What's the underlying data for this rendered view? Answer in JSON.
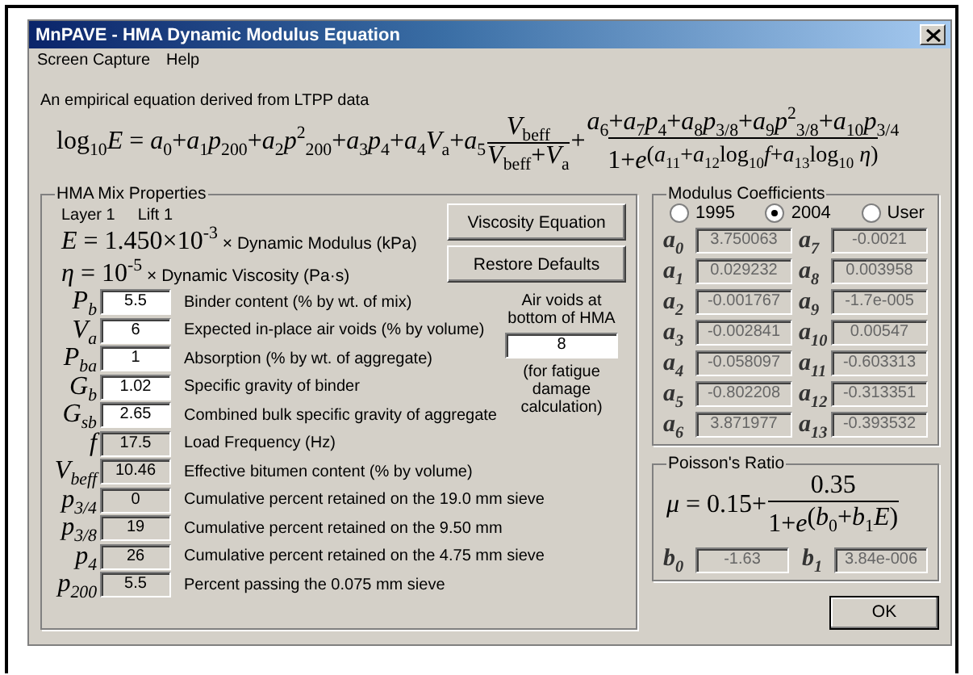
{
  "window": {
    "title": "MnPAVE - HMA Dynamic Modulus Equation"
  },
  "menu": [
    "Screen Capture",
    "Help"
  ],
  "intro": "An empirical equation derived from LTPP data",
  "equation": {
    "lhs": "log$_{10}$*E* = *a*$_{0}$+*a*$_{1}$*p*$_{200}$+*a*$_{2}$*p*$^{2}$$_{200}$+*a*$_{3}$*p*$_{4}$+*a*$_{4}$*V*$_{a}$+*a*$_{5}$",
    "frac1": {
      "num": "*V*$_{beff}$",
      "den": "*V*$_{beff}$+*V*$_{a}$"
    },
    "plus": "+",
    "frac2": {
      "num": "*a*$_{6}$+*a*$_{7}$*p*$_{4}$+*a*$_{8}$*p*$_{3/8}$+*a*$_{9}$*p*$^{2}$$_{3/8}$+*a*$_{10}$*p*$_{3/4}$",
      "den": "1+*e*",
      "exponent": "(*a*$_{11}$+*a*$_{12}$log$_{10}$*f*+*a*$_{13}$log$_{10}$ *η*)"
    }
  },
  "mix": {
    "title": "HMA Mix Properties",
    "layer": "Layer 1",
    "lift": "Lift 1",
    "defs": [
      {
        "math": "*E* = 1.450×10$^{-3}$",
        "text": "× Dynamic Modulus (kPa)"
      },
      {
        "math": "*η* = 10$^{-5}$",
        "text": "× Dynamic Viscosity (Pa·s)"
      }
    ],
    "buttons": [
      "Viscosity Equation",
      "Restore Defaults"
    ],
    "fields": [
      {
        "symbol": "P$_{b}$",
        "value": "5.5",
        "label": "Binder content (% by wt. of mix)",
        "editable": true
      },
      {
        "symbol": "V$_{a}$",
        "value": "6",
        "label": "Expected in-place air voids (% by volume)",
        "editable": true
      },
      {
        "symbol": "P$_{ba}$",
        "value": "1",
        "label": "Absorption (% by wt. of aggregate)",
        "editable": true
      },
      {
        "symbol": "G$_{b}$",
        "value": "1.02",
        "label": "Specific gravity of binder",
        "editable": true
      },
      {
        "symbol": "G$_{sb}$",
        "value": "2.65",
        "label": "Combined bulk specific gravity of aggregate",
        "editable": true
      },
      {
        "symbol": "f",
        "value": "17.5",
        "label": "Load Frequency (Hz)",
        "editable": false
      },
      {
        "symbol": "V$_{beff}$",
        "value": "10.46",
        "label": "Effective bitumen content (% by volume)",
        "editable": false
      },
      {
        "symbol": "p$_{3/4}$",
        "value": "0",
        "label": "Cumulative percent retained on the 19.0 mm sieve",
        "editable": false
      },
      {
        "symbol": "p$_{3/8}$",
        "value": "19",
        "label": "Cumulative percent retained on the 9.50 mm",
        "editable": false
      },
      {
        "symbol": "p$_{4}$",
        "value": "26",
        "label": "Cumulative percent retained on the 4.75 mm sieve",
        "editable": false
      },
      {
        "symbol": "p$_{200}$",
        "value": "5.5",
        "label": "Percent passing the 0.075 mm sieve",
        "editable": false
      }
    ],
    "air_voids": {
      "label": "Air voids at bottom of HMA",
      "value": "8",
      "note": "(for fatigue damage calculation)"
    }
  },
  "coefficients": {
    "title": "Modulus Coefficients",
    "options": [
      {
        "label": "1995",
        "selected": false
      },
      {
        "label": "2004",
        "selected": true
      },
      {
        "label": "User",
        "selected": false
      }
    ],
    "items": [
      {
        "symbol": "a$_{0}$",
        "value": "3.750063"
      },
      {
        "symbol": "a$_{7}$",
        "value": "-0.0021"
      },
      {
        "symbol": "a$_{1}$",
        "value": "0.029232"
      },
      {
        "symbol": "a$_{8}$",
        "value": "0.003958"
      },
      {
        "symbol": "a$_{2}$",
        "value": "-0.001767"
      },
      {
        "symbol": "a$_{9}$",
        "value": "-1.7e-005"
      },
      {
        "symbol": "a$_{3}$",
        "value": "-0.002841"
      },
      {
        "symbol": "a$_{10}$",
        "value": "0.00547"
      },
      {
        "symbol": "a$_{4}$",
        "value": "-0.058097"
      },
      {
        "symbol": "a$_{11}$",
        "value": "-0.603313"
      },
      {
        "symbol": "a$_{5}$",
        "value": "-0.802208"
      },
      {
        "symbol": "a$_{12}$",
        "value": "-0.313351"
      },
      {
        "symbol": "a$_{6}$",
        "value": "3.871977"
      },
      {
        "symbol": "a$_{13}$",
        "value": "-0.393532"
      }
    ]
  },
  "poisson": {
    "title": "Poisson's Ratio",
    "lhs": "*μ* = 0.15+",
    "num": "0.35",
    "den": "1+*e*",
    "exponent": "(*b*$_{0}$+*b*$_{1}$*E*)",
    "items": [
      {
        "symbol": "b$_{0}$",
        "value": "-1.63"
      },
      {
        "symbol": "b$_{1}$",
        "value": "3.84e-006"
      }
    ]
  },
  "ok": "OK"
}
